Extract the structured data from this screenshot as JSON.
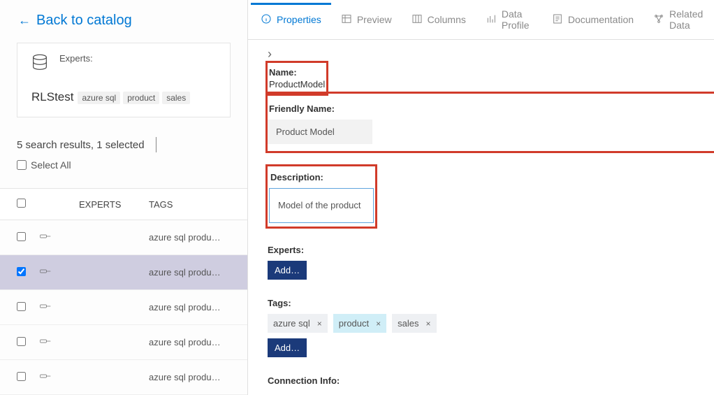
{
  "left": {
    "back_label": "Back to catalog",
    "card": {
      "experts_label": "Experts:",
      "title": "RLStest",
      "tags": [
        "azure sql",
        "product",
        "sales"
      ]
    },
    "results_text": "5 search results, 1 selected",
    "select_all_label": "Select All",
    "table": {
      "headers": {
        "experts": "EXPERTS",
        "tags": "TAGS"
      },
      "rows": [
        {
          "selected": false,
          "tags": "azure sql produ…"
        },
        {
          "selected": true,
          "tags": "azure sql produ…"
        },
        {
          "selected": false,
          "tags": "azure sql produ…"
        },
        {
          "selected": false,
          "tags": "azure sql produ…"
        },
        {
          "selected": false,
          "tags": "azure sql produ…"
        }
      ]
    }
  },
  "tabs": [
    {
      "key": "properties",
      "label": "Properties",
      "active": true
    },
    {
      "key": "preview",
      "label": "Preview",
      "active": false
    },
    {
      "key": "columns",
      "label": "Columns",
      "active": false
    },
    {
      "key": "data-profile",
      "label": "Data Profile",
      "active": false
    },
    {
      "key": "documentation",
      "label": "Documentation",
      "active": false
    },
    {
      "key": "related-data",
      "label": "Related Data",
      "active": false
    }
  ],
  "props": {
    "name_label": "Name:",
    "name_value": "ProductModel",
    "friendly_label": "Friendly Name:",
    "friendly_value": "Product Model",
    "desc_label": "Description:",
    "desc_value": "Model of the product",
    "experts_label": "Experts:",
    "tags_label": "Tags:",
    "add_label": "Add…",
    "tags": [
      {
        "text": "azure sql",
        "highlight": false
      },
      {
        "text": "product",
        "highlight": true
      },
      {
        "text": "sales",
        "highlight": false
      }
    ],
    "conn_label": "Connection Info:"
  }
}
